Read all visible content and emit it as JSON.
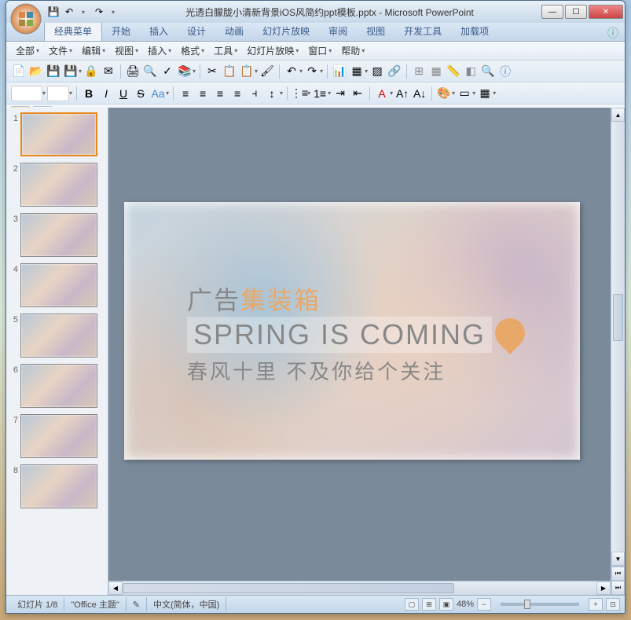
{
  "window": {
    "title": "光透白朦胧小清新背景iOS风简约ppt模板.pptx - Microsoft PowerPoint",
    "app_name": "Microsoft PowerPoint"
  },
  "ribbon_tabs": [
    "经典菜单",
    "开始",
    "插入",
    "设计",
    "动画",
    "幻灯片放映",
    "审阅",
    "视图",
    "开发工具",
    "加载项"
  ],
  "active_ribbon_tab": 0,
  "classic_menu": [
    "全部",
    "文件",
    "编辑",
    "视图",
    "插入",
    "格式",
    "工具",
    "幻灯片放映",
    "窗口",
    "帮助"
  ],
  "slide": {
    "title1_a": "广告",
    "title1_b": "集装箱",
    "title2": "SPRING IS COMING",
    "title3": "春风十里 不及你给个关注"
  },
  "thumbnails": [
    1,
    2,
    3,
    4,
    5,
    6,
    7,
    8
  ],
  "selected_thumb": 1,
  "status": {
    "slide_counter": "幻灯片 1/8",
    "theme": "\"Office 主题\"",
    "language": "中文(简体，中国)",
    "zoom": "48%"
  },
  "icons": {
    "save": "💾",
    "undo": "↶",
    "redo": "↷",
    "new": "📄",
    "open": "📂",
    "print": "🖨",
    "preview": "🔍",
    "cut": "✂",
    "copy": "📋",
    "paste": "📋",
    "bold": "B",
    "italic": "I",
    "underline": "U",
    "strike": "S",
    "help": "?"
  }
}
